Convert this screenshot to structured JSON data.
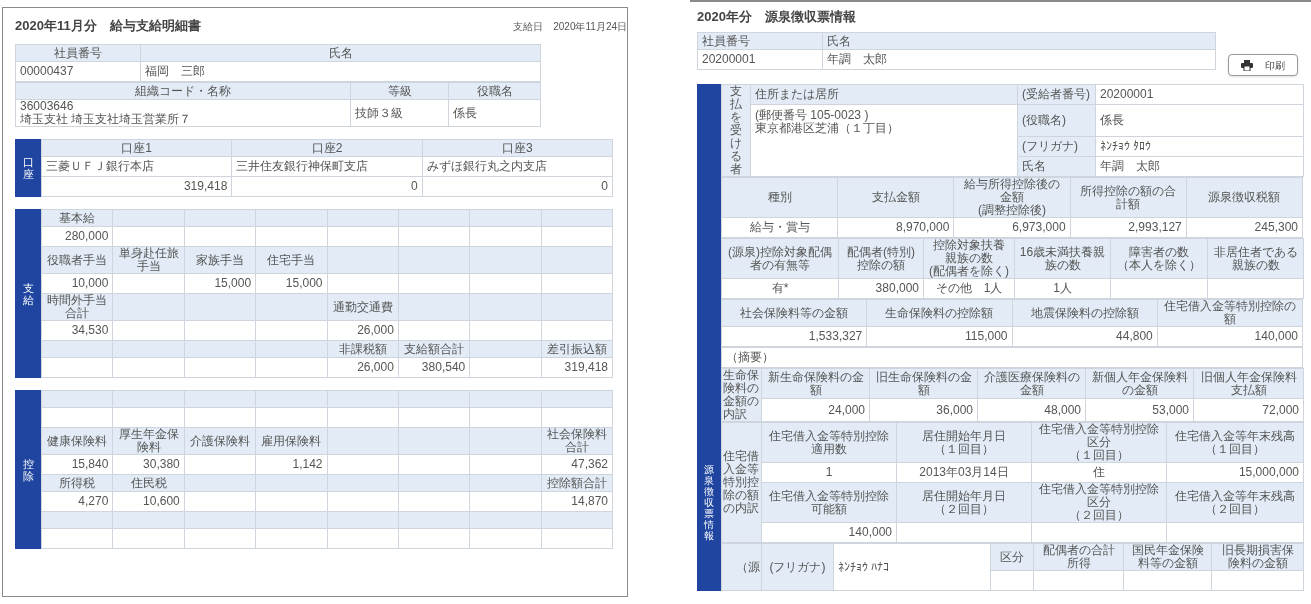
{
  "payslip": {
    "title": "2020年11月分　給与支給明細書",
    "pay_date": "支給日　2020年11月24日",
    "employee_tables": [
      [
        [
          {
            "text": "社員番号",
            "kind": "head"
          },
          {
            "text": "氏名",
            "kind": "head"
          }
        ],
        [
          {
            "text": "00000437",
            "kind": "text"
          },
          {
            "text": "福岡　三郎",
            "kind": "text"
          }
        ]
      ],
      [
        [
          {
            "text": "組織コード・名称",
            "kind": "head"
          },
          {
            "text": "等級",
            "kind": "head"
          },
          {
            "text": "役職名",
            "kind": "head"
          }
        ],
        [
          {
            "text": "36003646\n埼玉支社 埼玉支社埼玉営業所７",
            "kind": "text"
          },
          {
            "text": "技師３級",
            "kind": "text"
          },
          {
            "text": "係長",
            "kind": "text"
          }
        ]
      ]
    ],
    "sections": [
      {
        "label": "口座",
        "rows": [
          [
            {
              "text": "口座1",
              "kind": "head"
            },
            {
              "text": "口座2",
              "kind": "head"
            },
            {
              "text": "口座3",
              "kind": "head"
            }
          ],
          [
            {
              "text": "三菱ＵＦＪ銀行本店",
              "kind": "text"
            },
            {
              "text": "三井住友銀行神保町支店",
              "kind": "text"
            },
            {
              "text": "みずほ銀行丸之内支店",
              "kind": "text"
            }
          ],
          [
            {
              "text": "319,418",
              "kind": "num"
            },
            {
              "text": "0",
              "kind": "num"
            },
            {
              "text": "0",
              "kind": "num"
            }
          ]
        ]
      },
      {
        "label": "支給",
        "rows": [
          [
            {
              "text": "基本給",
              "kind": "head"
            },
            {
              "kind": "head"
            },
            {
              "kind": "head"
            },
            {
              "kind": "head"
            },
            {
              "kind": "head"
            },
            {
              "kind": "head"
            },
            {
              "kind": "head"
            },
            {
              "kind": "head"
            }
          ],
          [
            {
              "text": "280,000",
              "kind": "num"
            },
            {
              "kind": "num"
            },
            {
              "kind": "num"
            },
            {
              "kind": "num"
            },
            {
              "kind": "num"
            },
            {
              "kind": "num"
            },
            {
              "kind": "num"
            },
            {
              "kind": "num"
            }
          ],
          [
            {
              "text": "役職者手当",
              "kind": "head"
            },
            {
              "text": "単身赴任旅手当",
              "kind": "head"
            },
            {
              "text": "家族手当",
              "kind": "head"
            },
            {
              "text": "住宅手当",
              "kind": "head"
            },
            {
              "kind": "head"
            },
            {
              "kind": "head"
            },
            {
              "kind": "head"
            },
            {
              "kind": "head"
            }
          ],
          [
            {
              "text": "10,000",
              "kind": "num"
            },
            {
              "kind": "num"
            },
            {
              "text": "15,000",
              "kind": "num"
            },
            {
              "text": "15,000",
              "kind": "num"
            },
            {
              "kind": "num"
            },
            {
              "kind": "num"
            },
            {
              "kind": "num"
            },
            {
              "kind": "num"
            }
          ],
          [
            {
              "text": "時間外手当合計",
              "kind": "head"
            },
            {
              "kind": "head"
            },
            {
              "kind": "head"
            },
            {
              "kind": "head"
            },
            {
              "text": "通勤交通費",
              "kind": "head"
            },
            {
              "kind": "head"
            },
            {
              "kind": "head"
            },
            {
              "kind": "head"
            }
          ],
          [
            {
              "text": "34,530",
              "kind": "num"
            },
            {
              "kind": "num"
            },
            {
              "kind": "num"
            },
            {
              "kind": "num"
            },
            {
              "text": "26,000",
              "kind": "num"
            },
            {
              "kind": "num"
            },
            {
              "kind": "num"
            },
            {
              "kind": "num"
            }
          ],
          [
            {
              "kind": "head"
            },
            {
              "kind": "head"
            },
            {
              "kind": "head"
            },
            {
              "kind": "head"
            },
            {
              "text": "非課税額",
              "kind": "head"
            },
            {
              "text": "支給額合計",
              "kind": "head"
            },
            {
              "kind": "head"
            },
            {
              "text": "差引振込額",
              "kind": "head"
            }
          ],
          [
            {
              "kind": "num"
            },
            {
              "kind": "num"
            },
            {
              "kind": "num"
            },
            {
              "kind": "num"
            },
            {
              "text": "26,000",
              "kind": "num"
            },
            {
              "text": "380,540",
              "kind": "num"
            },
            {
              "kind": "num"
            },
            {
              "text": "319,418",
              "kind": "num"
            }
          ]
        ]
      },
      {
        "label": "控除",
        "rows": [
          [
            {
              "kind": "head"
            },
            {
              "kind": "head"
            },
            {
              "kind": "head"
            },
            {
              "kind": "head"
            },
            {
              "kind": "head"
            },
            {
              "kind": "head"
            },
            {
              "kind": "head"
            },
            {
              "kind": "head"
            }
          ],
          [
            {
              "kind": "num"
            },
            {
              "kind": "num"
            },
            {
              "kind": "num"
            },
            {
              "kind": "num"
            },
            {
              "kind": "num"
            },
            {
              "kind": "num"
            },
            {
              "kind": "num"
            },
            {
              "kind": "num"
            }
          ],
          [
            {
              "text": "健康保険料",
              "kind": "head"
            },
            {
              "text": "厚生年金保険料",
              "kind": "head"
            },
            {
              "text": "介護保険料",
              "kind": "head"
            },
            {
              "text": "雇用保険料",
              "kind": "head"
            },
            {
              "kind": "head"
            },
            {
              "kind": "head"
            },
            {
              "kind": "head"
            },
            {
              "text": "社会保険料合計",
              "kind": "head"
            }
          ],
          [
            {
              "text": "15,840",
              "kind": "num"
            },
            {
              "text": "30,380",
              "kind": "num"
            },
            {
              "kind": "num"
            },
            {
              "text": "1,142",
              "kind": "num"
            },
            {
              "kind": "num"
            },
            {
              "kind": "num"
            },
            {
              "kind": "num"
            },
            {
              "text": "47,362",
              "kind": "num"
            }
          ],
          [
            {
              "text": "所得税",
              "kind": "head"
            },
            {
              "text": "住民税",
              "kind": "head"
            },
            {
              "kind": "head"
            },
            {
              "kind": "head"
            },
            {
              "kind": "head"
            },
            {
              "kind": "head"
            },
            {
              "kind": "head"
            },
            {
              "text": "控除額合計",
              "kind": "head"
            }
          ],
          [
            {
              "text": "4,270",
              "kind": "num"
            },
            {
              "text": "10,600",
              "kind": "num"
            },
            {
              "kind": "num"
            },
            {
              "kind": "num"
            },
            {
              "kind": "num"
            },
            {
              "kind": "num"
            },
            {
              "kind": "num"
            },
            {
              "text": "14,870",
              "kind": "num"
            }
          ],
          [
            {
              "kind": "head"
            },
            {
              "kind": "head"
            },
            {
              "kind": "head"
            },
            {
              "kind": "head"
            },
            {
              "kind": "head"
            },
            {
              "kind": "head"
            },
            {
              "kind": "head"
            },
            {
              "kind": "head"
            }
          ],
          [
            {
              "kind": "num"
            },
            {
              "kind": "num"
            },
            {
              "kind": "num"
            },
            {
              "kind": "num"
            },
            {
              "kind": "num"
            },
            {
              "kind": "num"
            },
            {
              "kind": "num"
            },
            {
              "kind": "num"
            }
          ]
        ]
      }
    ]
  },
  "withholding": {
    "title": "2020年分　源泉徴収票情報",
    "employee_table": [
      [
        {
          "text": "社員番号",
          "kind": "headl"
        },
        {
          "text": "氏名",
          "kind": "headl"
        }
      ],
      [
        {
          "text": "20200001",
          "kind": "text"
        },
        {
          "text": "年調　太郎",
          "kind": "text"
        }
      ]
    ],
    "print_button": "印刷",
    "section_label": "源泉徴収票情報",
    "blocks": [
      [
        [
          {
            "text": "支払を受ける者",
            "kind": "vlabel"
          },
          {
            "text": "住所または居所",
            "kind": "headl"
          },
          {
            "text": "(受給者番号)",
            "kind": "headl"
          },
          {
            "text": "20200001",
            "kind": "text"
          }
        ],
        [
          {
            "text": "(郵便番号 105-0023 )\n東京都港区芝浦（１丁目）",
            "kind": "block"
          },
          {
            "text": "(役職名)",
            "kind": "headl"
          },
          {
            "text": "係長",
            "kind": "text"
          }
        ],
        [
          {
            "text": "(フリガナ)",
            "kind": "headl"
          },
          {
            "text": "ﾈﾝﾁｮｳ ﾀﾛｳ",
            "kind": "text"
          }
        ],
        [
          {
            "text": "氏名",
            "kind": "headl"
          },
          {
            "text": "年調　太郎",
            "kind": "text"
          }
        ]
      ],
      [
        [
          {
            "text": "種別",
            "kind": "head"
          },
          {
            "text": "支払金額",
            "kind": "head"
          },
          {
            "text": "給与所得控除後の金額(調整控除後)",
            "kind": "head"
          },
          {
            "text": "所得控除の額の合計額",
            "kind": "head"
          },
          {
            "text": "源泉徴収税額",
            "kind": "head"
          }
        ],
        [
          {
            "text": "給与・賞与",
            "kind": "center"
          },
          {
            "text": "8,970,000",
            "kind": "num"
          },
          {
            "text": "6,973,000",
            "kind": "num"
          },
          {
            "text": "2,993,127",
            "kind": "num"
          },
          {
            "text": "245,300",
            "kind": "num"
          }
        ]
      ],
      [
        [
          {
            "text": "(源泉)控除対象配偶者の有無等",
            "kind": "head"
          },
          {
            "text": "配偶者(特別)控除の額",
            "kind": "head"
          },
          {
            "text": "控除対象扶養親族の数(配偶者を除く)",
            "kind": "head"
          },
          {
            "text": "16歳未満扶養親族の数",
            "kind": "head"
          },
          {
            "text": "障害者の数（本人を除く）",
            "kind": "head"
          },
          {
            "text": "非居住者である親族の数",
            "kind": "head"
          }
        ],
        [
          {
            "text": "有*",
            "kind": "center"
          },
          {
            "text": "380,000",
            "kind": "num"
          },
          {
            "text": "その他　1人",
            "kind": "center"
          },
          {
            "text": "1人",
            "kind": "center"
          },
          {
            "kind": "num"
          },
          {
            "kind": "num"
          }
        ]
      ],
      [
        [
          {
            "text": "社会保険料等の金額",
            "kind": "head"
          },
          {
            "text": "生命保険料の控除額",
            "kind": "head"
          },
          {
            "text": "地震保険料の控除額",
            "kind": "head"
          },
          {
            "text": "住宅借入金等特別控除の額",
            "kind": "head"
          }
        ],
        [
          {
            "text": "1,533,327",
            "kind": "num"
          },
          {
            "text": "115,000",
            "kind": "num"
          },
          {
            "text": "44,800",
            "kind": "num"
          },
          {
            "text": "140,000",
            "kind": "num"
          }
        ]
      ],
      [
        [
          {
            "text": "（摘要）",
            "kind": "text"
          }
        ]
      ],
      [
        [
          {
            "text": "生命保険料の金額の内訳",
            "kind": "label"
          },
          {
            "text": "新生命保険料の金額",
            "kind": "head"
          },
          {
            "text": "旧生命保険料の金額",
            "kind": "head"
          },
          {
            "text": "介護医療保険料の金額",
            "kind": "head"
          },
          {
            "text": "新個人年金保険料の金額",
            "kind": "head"
          },
          {
            "text": "旧個人年金保険料支払額",
            "kind": "head"
          }
        ],
        [
          {
            "text": "24,000",
            "kind": "num"
          },
          {
            "text": "36,000",
            "kind": "num"
          },
          {
            "text": "48,000",
            "kind": "num"
          },
          {
            "text": "53,000",
            "kind": "num"
          },
          {
            "text": "72,000",
            "kind": "num"
          }
        ]
      ],
      [
        [
          {
            "text": "住宅借入金等特別控除の額の内訳",
            "kind": "label"
          },
          {
            "text": "住宅借入金等特別控除適用数",
            "kind": "head"
          },
          {
            "text": "居住開始年月日（１回目）",
            "kind": "head"
          },
          {
            "text": "住宅借入金等特別控除区分（１回目）",
            "kind": "head"
          },
          {
            "text": "住宅借入金等年末残高（１回目）",
            "kind": "head"
          }
        ],
        [
          {
            "text": "1",
            "kind": "center"
          },
          {
            "text": "2013年03月14日",
            "kind": "center"
          },
          {
            "text": "住",
            "kind": "center"
          },
          {
            "text": "15,000,000",
            "kind": "num"
          }
        ],
        [
          {
            "text": "住宅借入金等特別控除可能額",
            "kind": "head"
          },
          {
            "text": "居住開始年月日（２回目）",
            "kind": "head"
          },
          {
            "text": "住宅借入金等特別控除区分（２回目）",
            "kind": "head"
          },
          {
            "text": "住宅借入金等年末残高（２回目）",
            "kind": "head"
          }
        ],
        [
          {
            "text": "140,000",
            "kind": "num"
          },
          {
            "kind": "num"
          },
          {
            "kind": "num"
          },
          {
            "kind": "num"
          }
        ]
      ],
      [
        [
          {
            "text": "（源",
            "kind": "vlabel"
          },
          {
            "text": "(フリガナ)",
            "kind": "head"
          },
          {
            "text": "ﾈﾝﾁｮｳ ﾊﾅｺ",
            "kind": "text"
          },
          {
            "text": "区分",
            "kind": "head"
          },
          {
            "text": "配偶者の合計所得",
            "kind": "head"
          },
          {
            "text": "国民年金保険料等の金額",
            "kind": "head"
          },
          {
            "text": "旧長期損害保険料の金額",
            "kind": "head"
          }
        ],
        [
          {
            "kind": "num"
          },
          {
            "kind": "num"
          },
          {
            "kind": "num"
          },
          {
            "kind": "num"
          }
        ]
      ]
    ]
  }
}
